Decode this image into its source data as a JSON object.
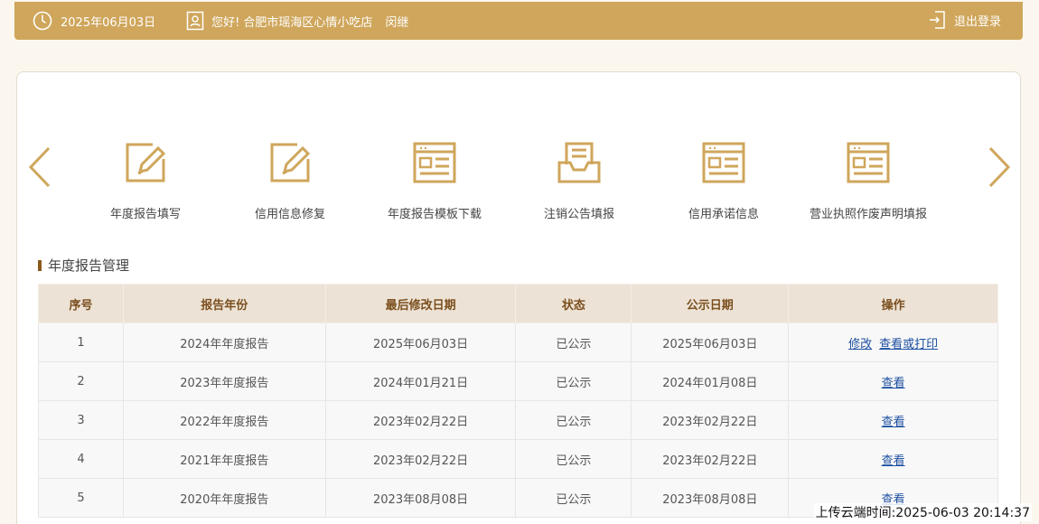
{
  "header": {
    "date": "2025年06月03日",
    "greeting": "您好!",
    "user_name": "合肥市瑶海区心情小吃店",
    "user_role": "闵继",
    "logout": "退出登录"
  },
  "quick_links": [
    {
      "label": "年度报告填写",
      "icon": "edit-icon"
    },
    {
      "label": "信用信息修复",
      "icon": "edit-icon"
    },
    {
      "label": "年度报告模板下载",
      "icon": "template-icon"
    },
    {
      "label": "注销公告填报",
      "icon": "inbox-doc-icon"
    },
    {
      "label": "信用承诺信息",
      "icon": "template-icon"
    },
    {
      "label": "营业执照作废声明填报",
      "icon": "template-icon"
    }
  ],
  "section": {
    "title": "年度报告管理"
  },
  "table": {
    "headers": [
      "序号",
      "报告年份",
      "最后修改日期",
      "状态",
      "公示日期",
      "操作"
    ],
    "rows": [
      {
        "no": "1",
        "year": "2024年年度报告",
        "modified": "2025年06月03日",
        "status": "已公示",
        "published": "2025年06月03日",
        "actions": [
          "修改",
          "查看或打印"
        ]
      },
      {
        "no": "2",
        "year": "2023年年度报告",
        "modified": "2024年01月21日",
        "status": "已公示",
        "published": "2024年01月08日",
        "actions": [
          "查看"
        ]
      },
      {
        "no": "3",
        "year": "2022年年度报告",
        "modified": "2023年02月22日",
        "status": "已公示",
        "published": "2023年02月22日",
        "actions": [
          "查看"
        ]
      },
      {
        "no": "4",
        "year": "2021年年度报告",
        "modified": "2023年02月22日",
        "status": "已公示",
        "published": "2023年02月22日",
        "actions": [
          "查看"
        ]
      },
      {
        "no": "5",
        "year": "2020年年度报告",
        "modified": "2023年08月08日",
        "status": "已公示",
        "published": "2023年08月08日",
        "actions": [
          "查看"
        ]
      }
    ]
  },
  "watermark": "上传云端时间:2025-06-03 20:14:37",
  "colors": {
    "accent": "#cfa65b",
    "header_bg": "#ece2d5",
    "link": "#1c4fa1"
  }
}
